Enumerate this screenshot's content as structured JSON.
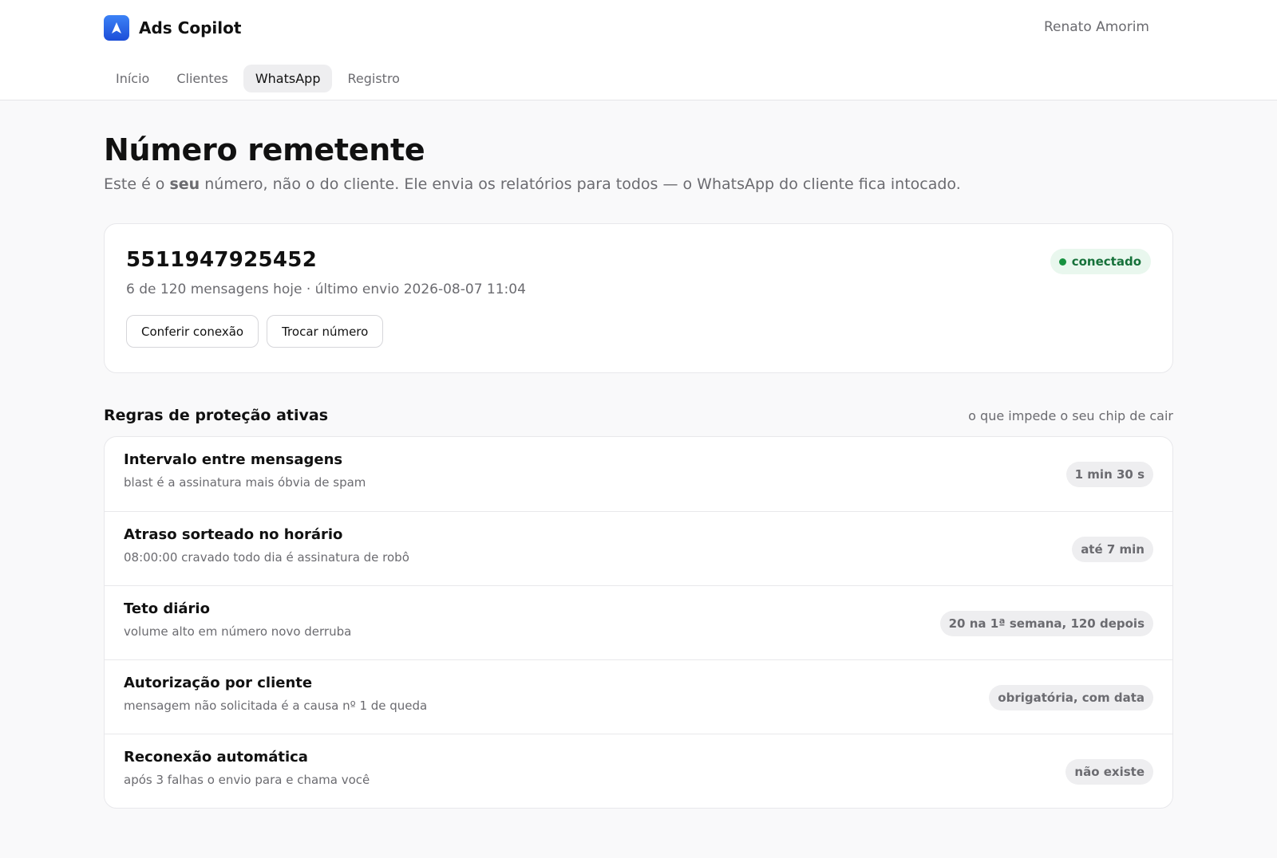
{
  "app": {
    "name": "Ads Copilot",
    "user": "Renato Amorim"
  },
  "nav": {
    "tabs": [
      "Início",
      "Clientes",
      "WhatsApp",
      "Registro"
    ],
    "active_tab": "WhatsApp"
  },
  "page": {
    "title": "Número remetente",
    "subtitle_before": "Este é o ",
    "subtitle_bold": "seu",
    "subtitle_after": " número, não o do cliente. Ele envia os relatórios para todos — o WhatsApp do cliente fica intocado."
  },
  "sender": {
    "number": "5511947925452",
    "meta": "6 de 120 mensagens hoje · último envio 2026-08-07 11:04",
    "status": "conectado",
    "status_color": "#16713a",
    "buttons": {
      "check": "Conferir conexão",
      "change": "Trocar número"
    }
  },
  "rules": {
    "title": "Regras de proteção ativas",
    "hint": "o que impede o seu chip de cair",
    "items": [
      {
        "name": "Intervalo entre mensagens",
        "desc": "blast é a assinatura mais óbvia de spam",
        "value": "1 min 30 s"
      },
      {
        "name": "Atraso sorteado no horário",
        "desc": "08:00:00 cravado todo dia é assinatura de robô",
        "value": "até 7 min"
      },
      {
        "name": "Teto diário",
        "desc": "volume alto em número novo derruba",
        "value": "20 na 1ª semana, 120 depois"
      },
      {
        "name": "Autorização por cliente",
        "desc": "mensagem não solicitada é a causa nº 1 de queda",
        "value": "obrigatória, com data"
      },
      {
        "name": "Reconexão automática",
        "desc": "após 3 falhas o envio para e chama você",
        "value": "não existe"
      }
    ]
  }
}
